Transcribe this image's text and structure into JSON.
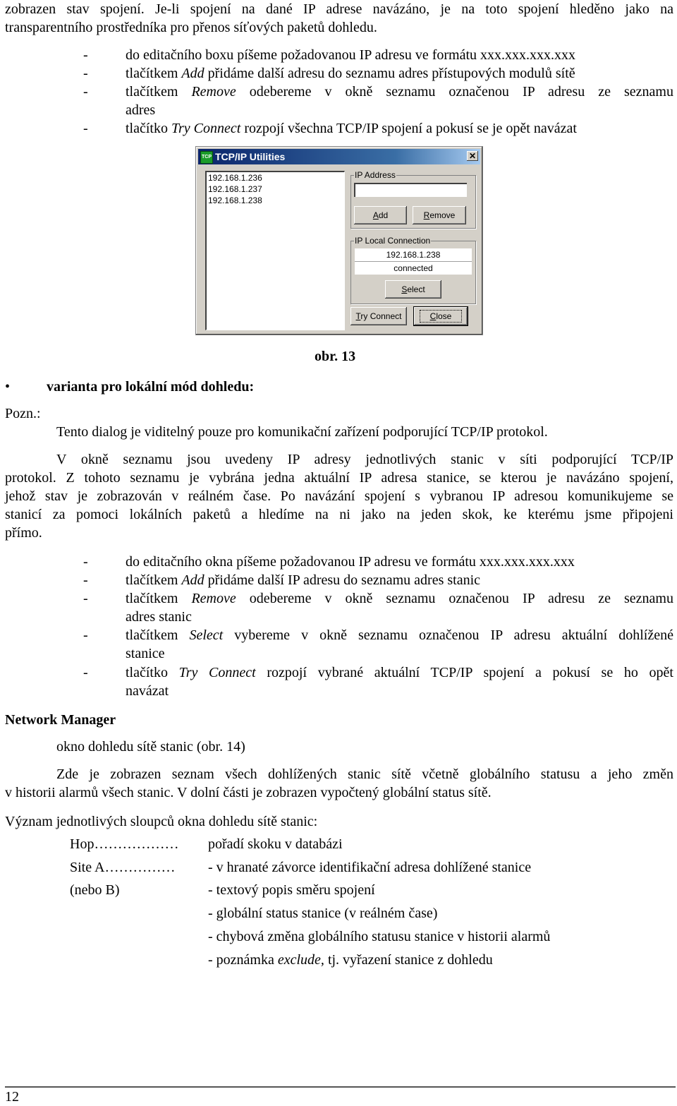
{
  "intro": {
    "line1": "zobrazen stav spojení. Je-li spojení na dané IP adrese navázáno, je na toto spojení hleděno jako na",
    "line2": "transparentního prostředníka pro přenos síťových paketů dohledu."
  },
  "list1": [
    {
      "pre": "do editačního boxu píšeme požadovanou IP adresu ve formátu xxx.xxx.xxx.xxx",
      "em": "",
      "post": ""
    },
    {
      "pre": "tlačítkem ",
      "em": "Add",
      "post": " přidáme další adresu do seznamu adres přístupových modulů sítě"
    },
    {
      "pre": "tlačítkem ",
      "em": "Remove",
      "post": " odebereme v okně seznamu označenou IP adresu ze seznamu",
      "cont": "adres"
    },
    {
      "pre": "tlačítko ",
      "em": "Try Connect",
      "post": " rozpojí všechna TCP/IP spojení a pokusí se je opět navázat"
    }
  ],
  "dialog": {
    "title": "TCP/IP Utilities",
    "icon_label": "TCP",
    "close_glyph": "✕",
    "addresses": [
      "192.168.1.236",
      "192.168.1.237",
      "192.168.1.238"
    ],
    "ip_address_group": "IP Address",
    "ip_address_value": "",
    "add_btn": {
      "accel": "A",
      "rest": "dd"
    },
    "remove_btn": {
      "accel": "R",
      "rest": "emove"
    },
    "local_group": "IP Local Connection",
    "local_ip": "192.168.1.238",
    "local_status": "connected",
    "select_btn": {
      "accel": "S",
      "rest": "elect"
    },
    "try_btn": {
      "accel": "T",
      "rest": "ry Connect"
    },
    "close_btn": {
      "accel": "C",
      "rest": "lose"
    }
  },
  "caption": "obr. 13",
  "bullet": {
    "glyph": "•",
    "text": "varianta pro lokální mód dohledu:"
  },
  "note": {
    "label": "Pozn.:",
    "line": "Tento dialog je viditelný pouze pro komunikační zařízení podporující TCP/IP protokol."
  },
  "para1": [
    "V okně seznamu jsou uvedeny IP adresy jednotlivých stanic v síti podporující TCP/IP",
    "protokol. Z tohoto seznamu je vybrána jedna aktuální IP adresa stanice, se kterou je navázáno spojení,",
    "jehož stav je zobrazován v reálném čase. Po navázání spojení s vybranou IP adresou komunikujeme se",
    "stanicí za pomoci lokálních paketů a hledíme na ni jako na jeden skok, ke kterému jsme připojeni",
    "přímo."
  ],
  "list2": [
    {
      "pre": "do editačního okna píšeme požadovanou IP adresu ve formátu xxx.xxx.xxx.xxx",
      "em": "",
      "post": ""
    },
    {
      "pre": "tlačítkem ",
      "em": "Add",
      "post": " přidáme další IP adresu do seznamu adres stanic"
    },
    {
      "pre": "tlačítkem ",
      "em": "Remove",
      "post": " odebereme v okně seznamu označenou IP adresu ze seznamu",
      "cont": "adres stanic"
    },
    {
      "pre": "tlačítkem ",
      "em": "Select",
      "post": " vybereme v okně seznamu označenou IP adresu aktuální dohlížené",
      "cont": "stanice"
    },
    {
      "pre": "tlačítko ",
      "em": "Try Connect",
      "post": " rozpojí vybrané aktuální TCP/IP spojení a pokusí se ho opět",
      "cont": "navázat"
    }
  ],
  "section": {
    "heading": "Network Manager",
    "subheading": "okno dohledu sítě stanic (obr. 14)",
    "para": [
      "Zde je zobrazen seznam všech dohlížených stanic sítě včetně globálního statusu a jeho změn",
      "v historii alarmů všech stanic. V dolní části je zobrazen vypočtený globální status sítě."
    ],
    "columns_intro": "Význam jednotlivých sloupců okna dohledu sítě stanic:"
  },
  "columns": [
    {
      "term": "Hop………………",
      "desc": "pořadí skoku v databázi"
    },
    {
      "term": "Site A……………",
      "desc": "- v hranaté závorce identifikační adresa dohlížené stanice"
    },
    {
      "term": "(nebo B)",
      "desc": "- textový popis směru spojení"
    },
    {
      "term": "",
      "desc": "- globální status stanice (v reálném čase)"
    },
    {
      "term": "",
      "desc": "- chybová změna globálního statusu stanice v historii alarmů"
    },
    {
      "term": "",
      "desc_pre": "- poznámka ",
      "desc_em": "exclude,",
      "desc_post": " tj. vyřazení stanice z dohledu"
    }
  ],
  "footer": {
    "page_number": "12"
  }
}
